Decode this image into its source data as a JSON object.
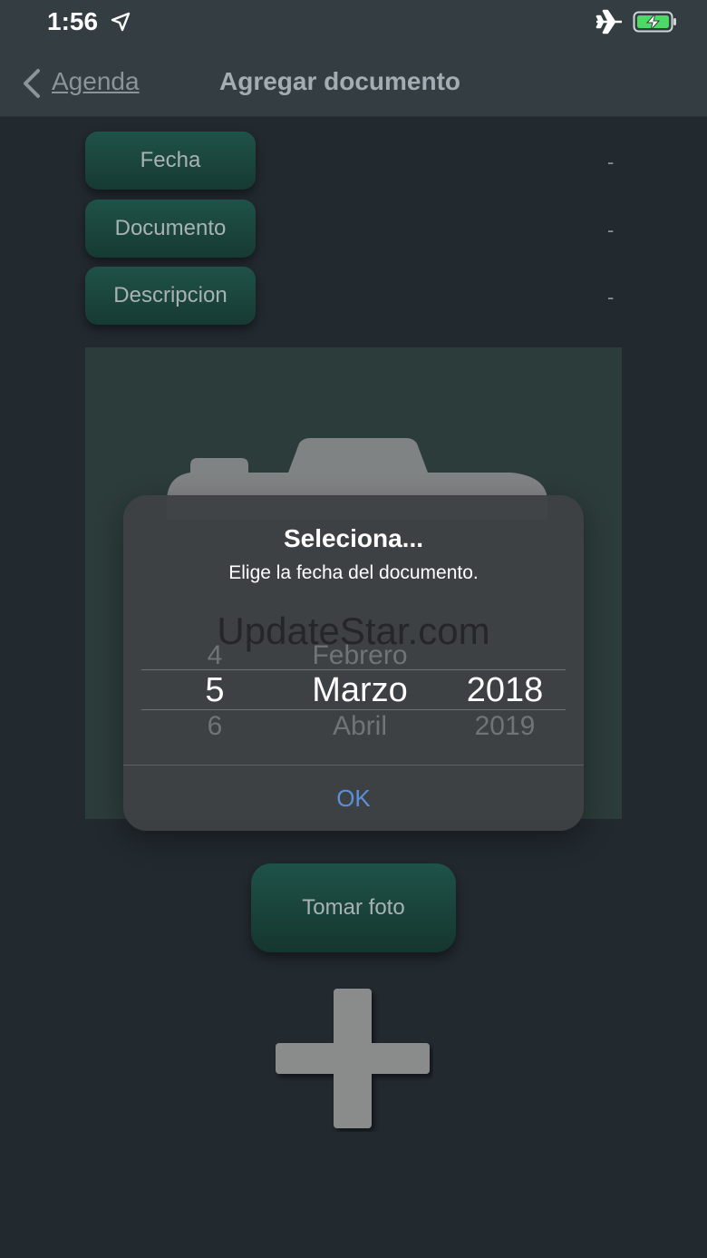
{
  "status": {
    "time": "1:56",
    "icons": [
      "location-arrow-icon",
      "airplane-icon",
      "battery-charging-icon"
    ],
    "battery_color": "#4cd964"
  },
  "nav": {
    "back_label": "Agenda",
    "title": "Agregar documento"
  },
  "fields": [
    {
      "label": "Fecha",
      "value": "-"
    },
    {
      "label": "Documento",
      "value": "-"
    },
    {
      "label": "Descripcion",
      "value": "-"
    }
  ],
  "dialog": {
    "title": "Seleciona...",
    "message": "Elige la fecha del documento.",
    "watermark": "UpdateStar.com",
    "picker": {
      "day": {
        "prev": "4",
        "selected": "5",
        "next": "6"
      },
      "month": {
        "prev": "Febrero",
        "selected": "Marzo",
        "next": "Abril"
      },
      "year": {
        "prev": "",
        "selected": "2018",
        "next": "2019"
      }
    },
    "ok_label": "OK",
    "ok_color": "#5b8fd6"
  },
  "actions": {
    "take_photo_label": "Tomar foto"
  },
  "colors": {
    "background": "#22292f",
    "bar": "#333d42",
    "button_green": "#1f5248"
  }
}
